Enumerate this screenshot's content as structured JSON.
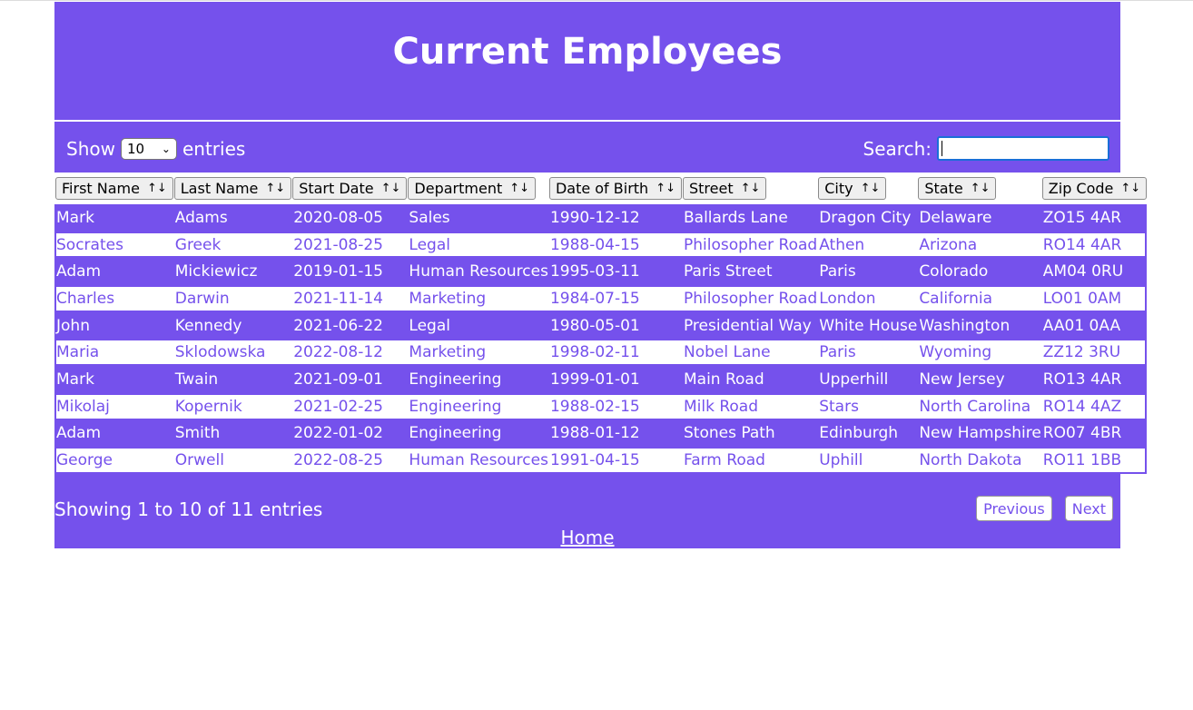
{
  "title": "Current Employees",
  "controls": {
    "show_label": "Show",
    "entries_select": "10",
    "entries_label": "entries",
    "search_label": "Search:",
    "search_value": ""
  },
  "columns": [
    "First Name",
    "Last Name",
    "Start Date",
    "Department",
    "Date of Birth",
    "Street",
    "City",
    "State",
    "Zip Code"
  ],
  "rows": [
    [
      "Mark",
      "Adams",
      "2020-08-05",
      "Sales",
      "1990-12-12",
      "Ballards Lane",
      "Dragon City",
      "Delaware",
      "ZO15 4AR"
    ],
    [
      "Socrates",
      "Greek",
      "2021-08-25",
      "Legal",
      "1988-04-15",
      "Philosopher Road",
      "Athen",
      "Arizona",
      "RO14 4AR"
    ],
    [
      "Adam",
      "Mickiewicz",
      "2019-01-15",
      "Human Resources",
      "1995-03-11",
      "Paris Street",
      "Paris",
      "Colorado",
      "AM04 0RU"
    ],
    [
      "Charles",
      "Darwin",
      "2021-11-14",
      "Marketing",
      "1984-07-15",
      "Philosopher Road",
      "London",
      "California",
      "LO01 0AM"
    ],
    [
      "John",
      "Kennedy",
      "2021-06-22",
      "Legal",
      "1980-05-01",
      "Presidential Way",
      "White House",
      "Washington",
      "AA01 0AA"
    ],
    [
      "Maria",
      "Sklodowska",
      "2022-08-12",
      "Marketing",
      "1998-02-11",
      "Nobel Lane",
      "Paris",
      "Wyoming",
      "ZZ12 3RU"
    ],
    [
      "Mark",
      "Twain",
      "2021-09-01",
      "Engineering",
      "1999-01-01",
      "Main Road",
      "Upperhill",
      "New Jersey",
      "RO13 4AR"
    ],
    [
      "Mikolaj",
      "Kopernik",
      "2021-02-25",
      "Engineering",
      "1988-02-15",
      "Milk Road",
      "Stars",
      "North Carolina",
      "RO14 4AZ"
    ],
    [
      "Adam",
      "Smith",
      "2022-01-02",
      "Engineering",
      "1988-01-12",
      "Stones Path",
      "Edinburgh",
      "New Hampshire",
      "RO07 4BR"
    ],
    [
      "George",
      "Orwell",
      "2022-08-25",
      "Human Resources",
      "1991-04-15",
      "Farm Road",
      "Uphill",
      "North Dakota",
      "RO11 1BB"
    ]
  ],
  "footer": {
    "info": "Showing 1 to 10 of 11 entries",
    "previous": "Previous",
    "next": "Next",
    "home": "Home"
  },
  "colors": {
    "accent": "#7551ec",
    "white": "#ffffff"
  }
}
